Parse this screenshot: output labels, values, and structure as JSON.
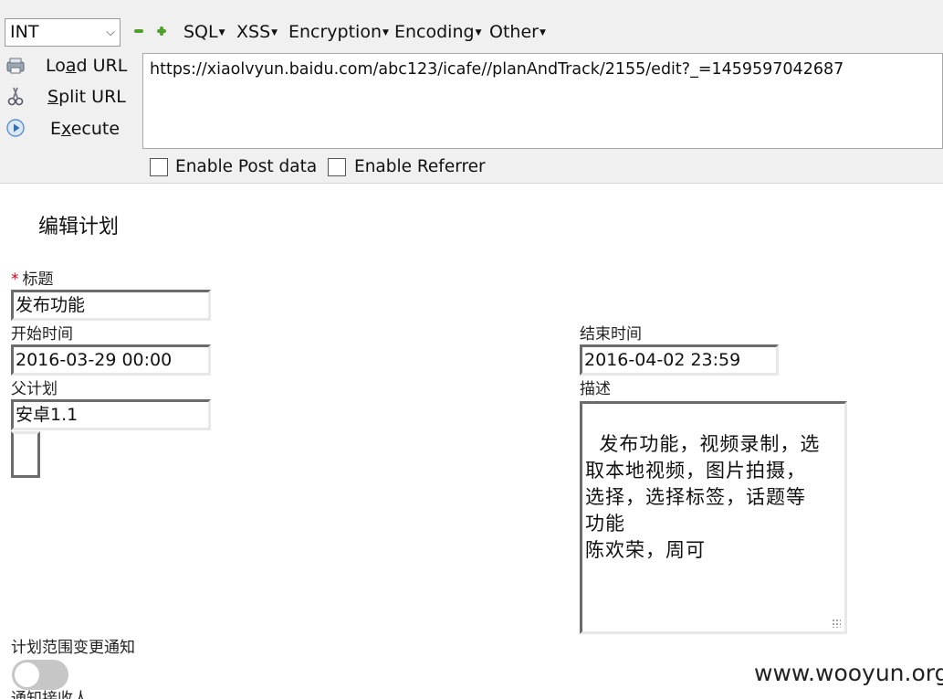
{
  "hackbar": {
    "select_value": "INT",
    "menus": [
      "SQL",
      "XSS",
      "Encryption",
      "Encoding",
      "Other"
    ],
    "load_url": {
      "pre": "Lo",
      "key": "a",
      "post": "d URL"
    },
    "split_url": {
      "pre": "",
      "key": "S",
      "post": "plit URL"
    },
    "execute": {
      "pre": "E",
      "key": "x",
      "post": "ecute"
    },
    "url": "https://xiaolvyun.baidu.com/abc123/icafe//planAndTrack/2155/edit?_=1459597042687",
    "enable_post_data": "Enable Post data",
    "enable_referrer": "Enable Referrer"
  },
  "form": {
    "page_title": "编辑计划",
    "required_mark": "*",
    "title_label": "标题",
    "title_value": "发布功能",
    "start_label": "开始时间",
    "start_value": "2016-03-29 00:00",
    "end_label": "结束时间",
    "end_value": "2016-04-02 23:59",
    "parent_label": "父计划",
    "parent_value": "安卓1.1",
    "desc_label": "描述",
    "desc_value": "发布功能，视频录制，选\n取本地视频，图片拍摄，\n选择，选择标签，话题等\n功能\n陈欢荣，周可",
    "notify_label": "计划范围变更通知",
    "notify_toggle_on": false,
    "cut_label": "通知接收人"
  },
  "watermark": "www.wooyun.org",
  "colors": {
    "toggle_off": "#c6c6c6",
    "required": "#d0021b",
    "plus_minus": "#4fa02c"
  }
}
